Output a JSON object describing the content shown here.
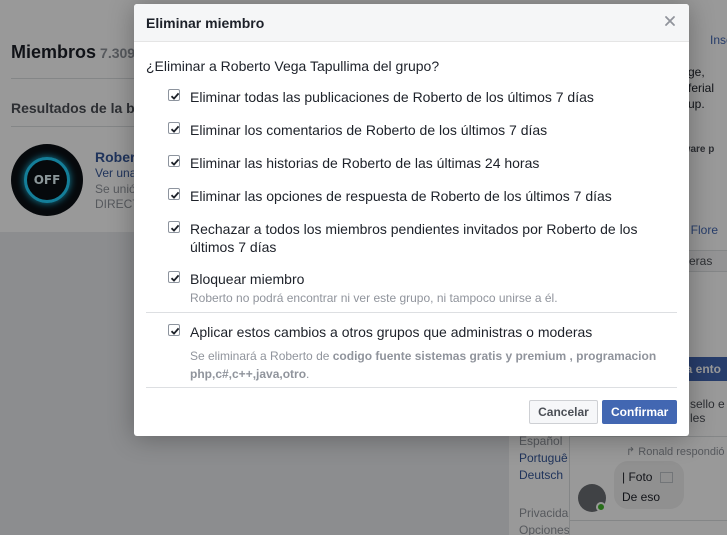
{
  "background": {
    "title": "Miembros",
    "count": "7.309",
    "results_heading": "Resultados de la b",
    "member": {
      "name": "Rober",
      "line1": "Ver una",
      "line2": "Se unió",
      "line3": "DIRECT",
      "avatar_text": "OFF"
    },
    "right": {
      "link_top": "Inse",
      "text_block": [
        "ge,",
        "ferial",
        "up."
      ],
      "software": "ftware p",
      "link_flore": "la Flore",
      "tab": "eras",
      "button": "ya ento",
      "sello": [
        "sello e",
        "les"
      ]
    },
    "languages": {
      "current": "Español",
      "items": [
        "Portuguê",
        "Deutsch"
      ]
    },
    "footer": [
      "Privacida",
      "Opciones"
    ],
    "chat": {
      "reply": "Ronald respondió",
      "photo_label": "Foto",
      "message": "De eso"
    }
  },
  "dialog": {
    "title": "Eliminar miembro",
    "question": "¿Eliminar a Roberto Vega Tapullima del grupo?",
    "options": [
      {
        "label": "Eliminar todas las publicaciones de Roberto de los últimos 7 días",
        "checked": true
      },
      {
        "label": "Eliminar los comentarios de Roberto de los últimos 7 días",
        "checked": true
      },
      {
        "label": "Eliminar las historias de Roberto de las últimas 24 horas",
        "checked": true
      },
      {
        "label": "Eliminar las opciones de respuesta de Roberto de los últimos 7 días",
        "checked": true
      },
      {
        "label_line1": "Rechazar a todos los miembros pendientes invitados por Roberto de los",
        "label_line2": "últimos 7 días",
        "checked": true
      },
      {
        "label": "Bloquear miembro",
        "sub": "Roberto no podrá encontrar ni ver este grupo, ni tampoco unirse a él.",
        "checked": true
      },
      {
        "label": "Aplicar estos cambios a otros grupos que administras o moderas",
        "sub_prefix": "Se eliminará a Roberto de ",
        "sub_groups": "codigo fuente sistemas gratis y premium , programacion php,c#,c++,java,otro",
        "sub_suffix": ".",
        "checked": true
      }
    ],
    "buttons": {
      "cancel": "Cancelar",
      "confirm": "Confirmar"
    }
  },
  "colors": {
    "primary": "#4267b2",
    "link": "#365899",
    "muted": "#90949c",
    "text": "#1d2129"
  }
}
